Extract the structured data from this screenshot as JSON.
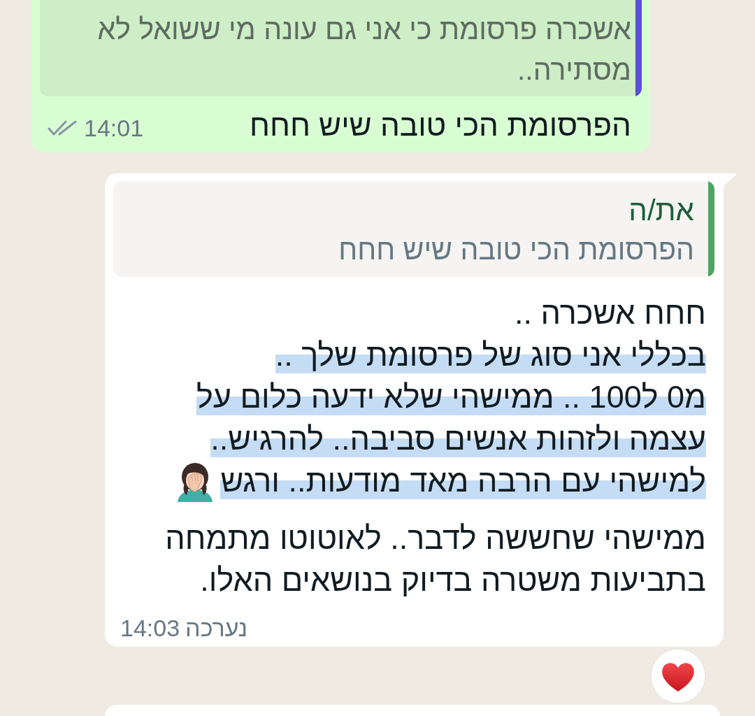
{
  "messages": [
    {
      "kind": "outgoing",
      "quote": {
        "color": "#5b4fd4",
        "text": "אשכרה פרסומת כי אני גם עונה מי ששואל לא מסתירה.."
      },
      "text": "הפרסומת הכי טובה שיש חחח",
      "time": "14:01",
      "read": false
    },
    {
      "kind": "incoming",
      "quote": {
        "color": "#4fa463",
        "sender": "את/ה",
        "text": "הפרסומת הכי טובה שיש חחח"
      },
      "lines": [
        {
          "text": "חחח אשכרה ..",
          "highlighted": false,
          "emoji": false
        },
        {
          "text": "בכללי אני סוג של פרסומת שלך ..",
          "highlighted": true,
          "emoji": false
        },
        {
          "text": "מ0 ל100 .. ממישהי שלא ידעה כלום על",
          "highlighted": true,
          "emoji": false
        },
        {
          "text": "עצמה ולזהות אנשים סביבה.. להרגיש..",
          "highlighted": true,
          "emoji": false
        },
        {
          "text": "למישהי עם הרבה מאד מודעות.. ורגש",
          "highlighted": true,
          "emoji": true
        },
        {
          "text": "ממישהי שחששה לדבר.. לאוטוטו מתמחה",
          "highlighted": false,
          "emoji": false
        },
        {
          "text": "בתביעות משטרה בדיוק בנושאים האלו.",
          "highlighted": false,
          "emoji": false
        }
      ],
      "edited_label": "נערכה",
      "time": "14:03",
      "reaction": true
    },
    {
      "kind": "incoming"
    }
  ]
}
